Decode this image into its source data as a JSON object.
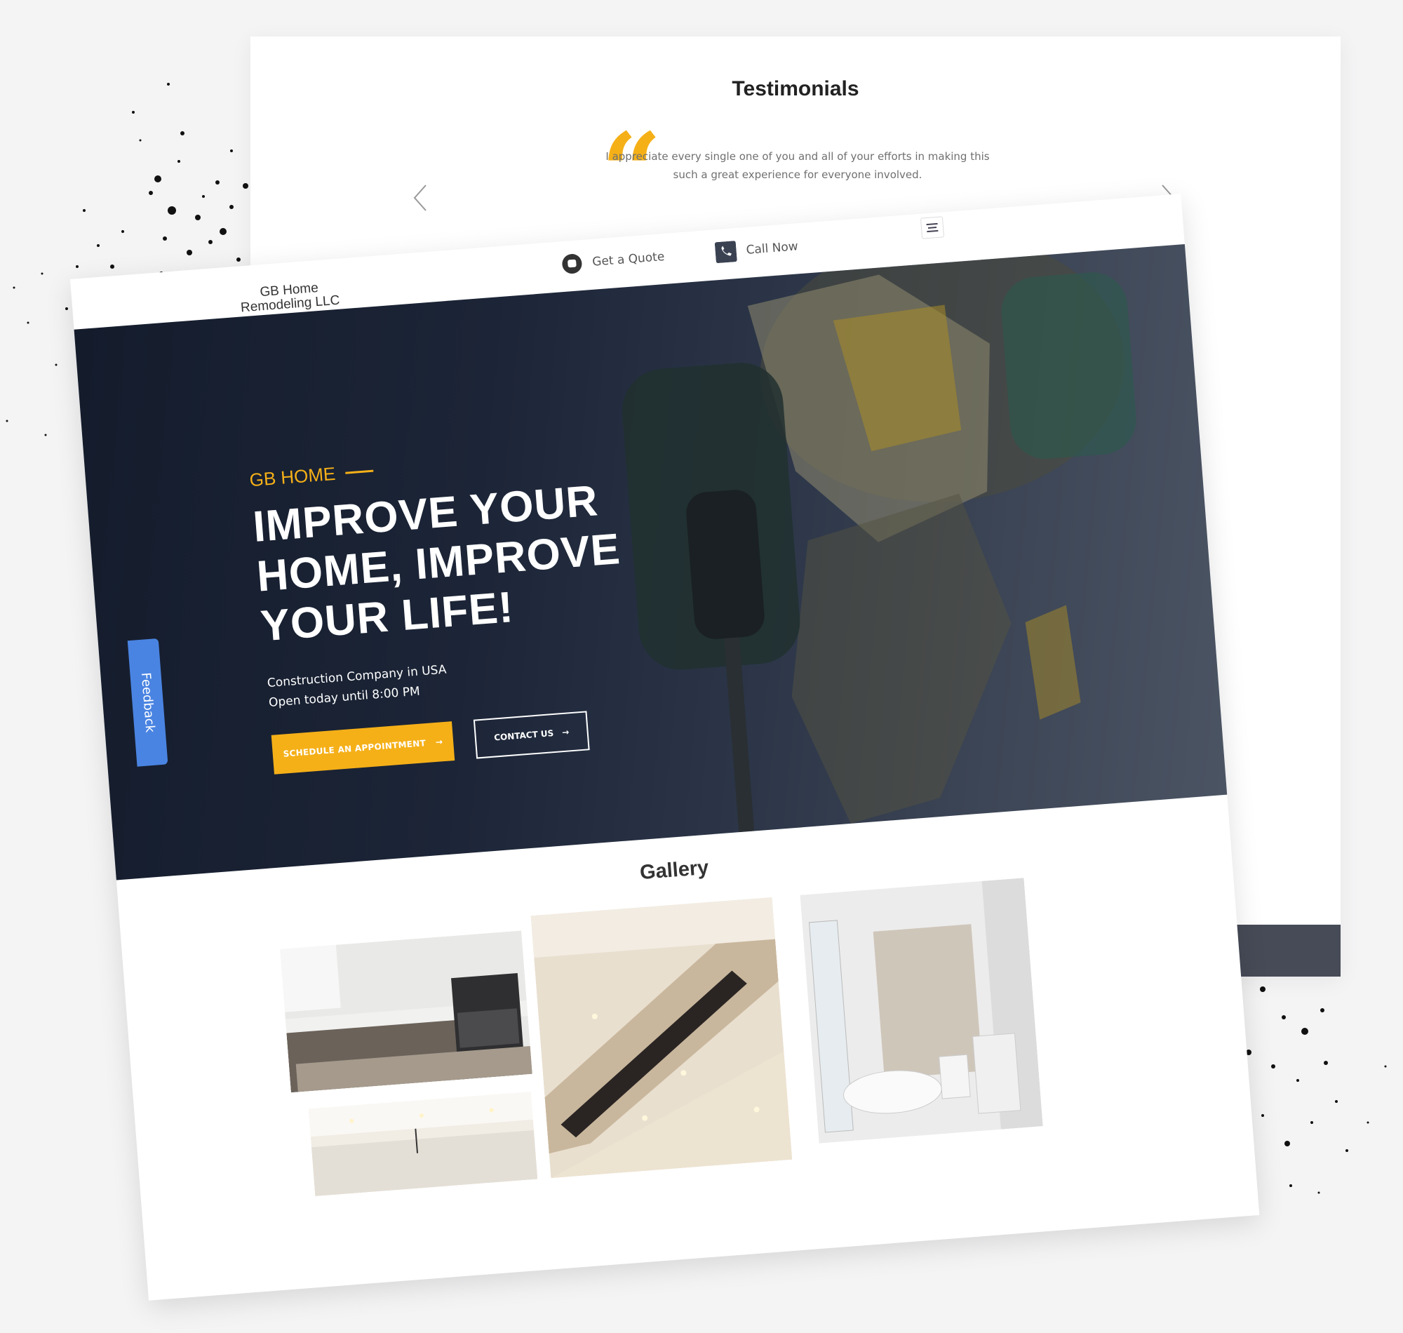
{
  "testimonials": {
    "title": "Testimonials",
    "quote": "I appreciate every single one of you and all of your efforts in making this such a great experience for everyone involved.",
    "prev_icon": "chevron-left-icon",
    "next_icon": "chevron-right-icon"
  },
  "nav": {
    "logo": "GB Home Remodeling LLC",
    "get_quote": "Get a Quote",
    "call_now": "Call Now",
    "menu_icon": "hamburger-menu-icon"
  },
  "hero": {
    "eyebrow": "GB HOME",
    "title": "IMPROVE YOUR HOME, IMPROVE YOUR LIFE!",
    "line1": "Construction Company in USA",
    "line2": "Open today until 8:00 PM",
    "primary_cta": "SCHEDULE AN APPOINTMENT",
    "secondary_cta": "CONTACT US"
  },
  "feedback_tab": "Feedback",
  "gallery": {
    "title": "Gallery",
    "images": [
      "kitchen",
      "staircase",
      "bathroom",
      "living-room"
    ]
  },
  "colors": {
    "accent": "#f5b018",
    "hero_dark": "#1c2537",
    "feedback_blue": "#4a84e2"
  }
}
